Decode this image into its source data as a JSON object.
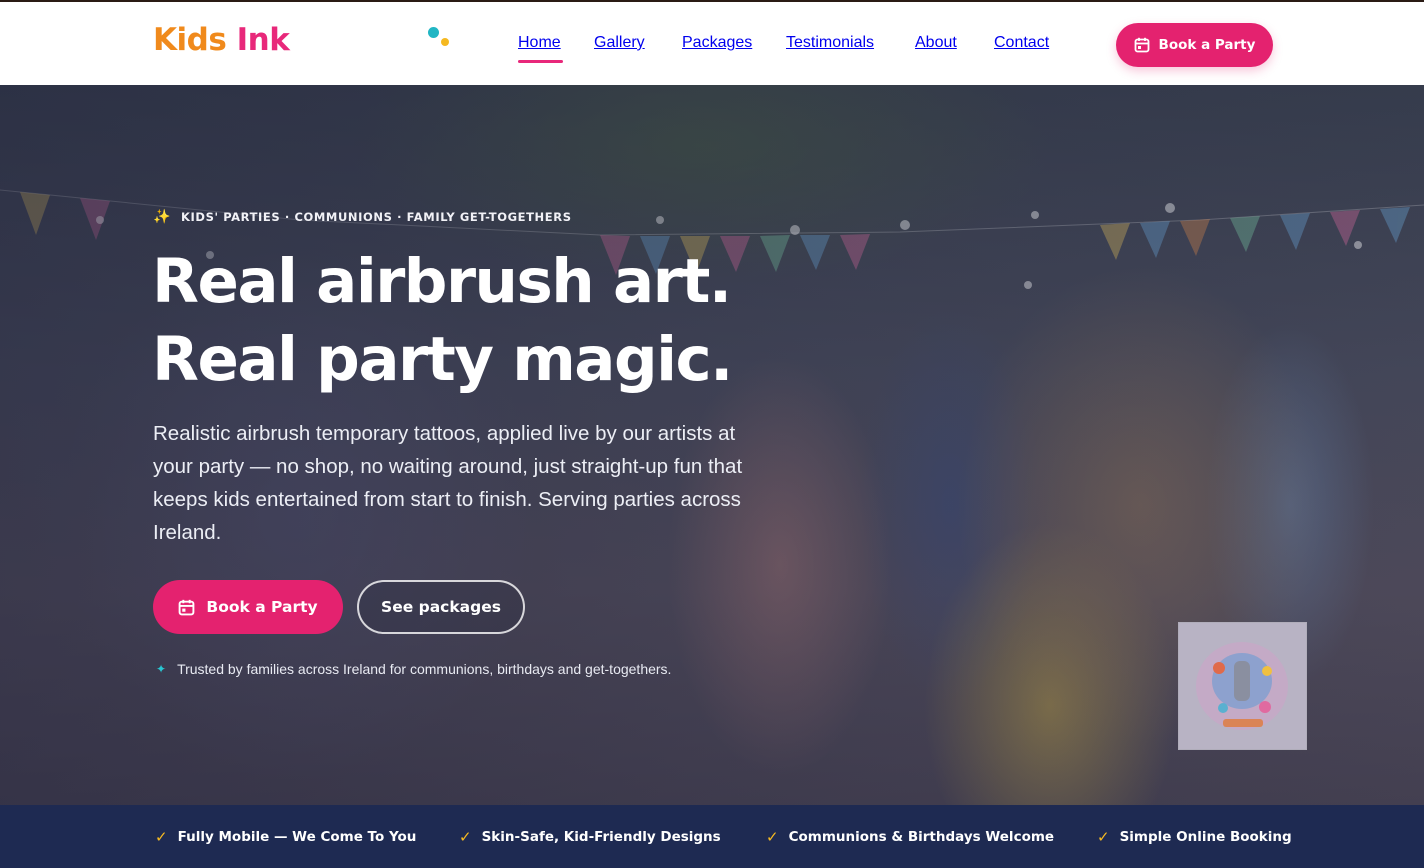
{
  "brand": {
    "word1": "Kids",
    "word2": "Ink"
  },
  "nav": {
    "items": [
      {
        "label": "Home",
        "active": true
      },
      {
        "label": "Gallery",
        "active": false
      },
      {
        "label": "Packages",
        "active": false
      },
      {
        "label": "Testimonials",
        "active": false
      },
      {
        "label": "About",
        "active": false
      },
      {
        "label": "Contact",
        "active": false
      }
    ],
    "cta_label": "Book a Party"
  },
  "hero": {
    "eyebrow": "KIDS' PARTIES · COMMUNIONS · FAMILY GET-TOGETHERS",
    "headline_line1": "Real airbrush art.",
    "headline_line2": "Real party magic.",
    "lede": "Realistic airbrush temporary tattoos, applied live by our artists at your party — no shop, no waiting around, just straight-up fun that keeps kids entertained from start to finish. Serving parties across Ireland.",
    "primary_cta": "Book a Party",
    "secondary_cta": "See packages",
    "trust_text": "Trusted by families across Ireland for communions, birthdays and get-togethers."
  },
  "features": [
    "Fully Mobile — We Come To You",
    "Skin-Safe, Kid-Friendly Designs",
    "Communions & Birthdays Welcome",
    "Simple Online Booking"
  ],
  "colors": {
    "brand_orange": "#f08a1c",
    "brand_pink": "#e4226f",
    "navy": "#1e2a52",
    "accent_yellow": "#f5b921",
    "accent_teal": "#21b6c4"
  },
  "icons": {
    "cta": "calendar-icon",
    "feature": "check-icon",
    "eyebrow": "sparkles-icon",
    "trust": "sparkle-icon"
  }
}
